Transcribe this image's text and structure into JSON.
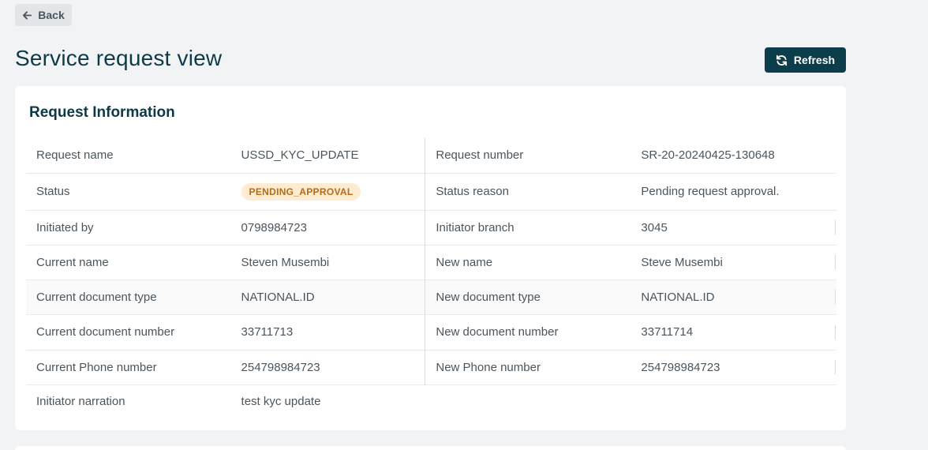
{
  "nav": {
    "back_label": "Back"
  },
  "header": {
    "title": "Service request view",
    "refresh_label": "Refresh"
  },
  "card": {
    "title": "Request Information",
    "rows": [
      {
        "label1": "Request name",
        "value1": "USSD_KYC_UPDATE",
        "label2": "Request number",
        "value2": "SR-20-20240425-130648"
      },
      {
        "label1": "Status",
        "value1": "PENDING_APPROVAL",
        "label2": "Status reason",
        "value2": "Pending request approval."
      },
      {
        "label1": "Initiated by",
        "value1": "0798984723",
        "label2": "Initiator branch",
        "value2": "3045"
      },
      {
        "label1": "Current name",
        "value1": "Steven Musembi",
        "label2": "New name",
        "value2": "Steve Musembi"
      },
      {
        "label1": "Current document type",
        "value1": "NATIONAL.ID",
        "label2": "New document type",
        "value2": "NATIONAL.ID"
      },
      {
        "label1": "Current document number",
        "value1": "33711713",
        "label2": "New document number",
        "value2": "33711714"
      },
      {
        "label1": "Current Phone number",
        "value1": "254798984723",
        "label2": "New Phone number",
        "value2": "254798984723"
      },
      {
        "label1": "Initiator narration",
        "value1": "test kyc update"
      }
    ]
  },
  "colors": {
    "primary": "#0b3d4a",
    "status_badge_bg": "#fdecd2",
    "status_badge_text": "#b86a14"
  },
  "icons": {
    "back": "arrow-left-icon",
    "refresh": "refresh-icon"
  }
}
